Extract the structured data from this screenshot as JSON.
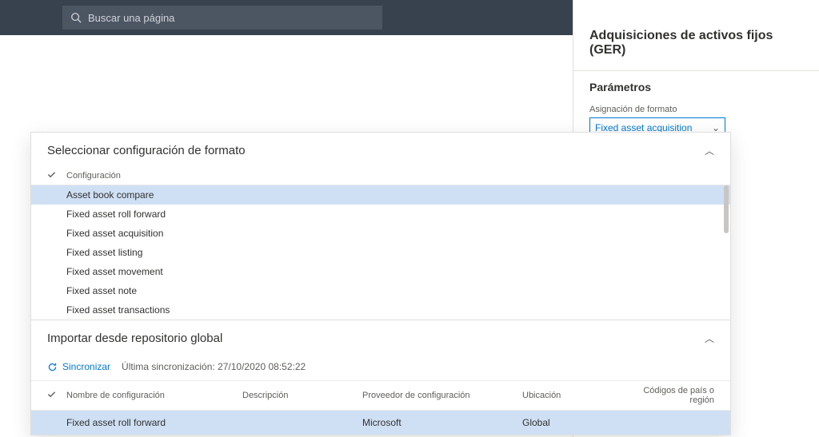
{
  "search": {
    "placeholder": "Buscar una página"
  },
  "rightPanel": {
    "title": "Adquisiciones de activos fijos (GER)",
    "section": "Parámetros",
    "formatFieldLabel": "Asignación de formato",
    "formatValue": "Fixed asset acquisition"
  },
  "overlay": {
    "formatSection": {
      "title": "Seleccionar configuración de formato",
      "columnHeader": "Configuración",
      "items": [
        {
          "name": "Asset book compare",
          "selected": true
        },
        {
          "name": "Fixed asset roll forward",
          "selected": false
        },
        {
          "name": "Fixed asset acquisition",
          "selected": false
        },
        {
          "name": "Fixed asset listing",
          "selected": false
        },
        {
          "name": "Fixed asset movement",
          "selected": false
        },
        {
          "name": "Fixed asset note",
          "selected": false
        },
        {
          "name": "Fixed asset transactions",
          "selected": false
        }
      ]
    },
    "importSection": {
      "title": "Importar desde repositorio global",
      "syncLabel": "Sincronizar",
      "syncInfo": "Última sincronización: 27/10/2020 08:52:22",
      "columns": {
        "name": "Nombre de configuración",
        "desc": "Descripción",
        "prov": "Proveedor de configuración",
        "ubic": "Ubicación",
        "cod": "Códigos de país o región"
      },
      "rows": [
        {
          "name": "Fixed asset roll forward",
          "desc": "",
          "prov": "Microsoft",
          "ubic": "Global",
          "cod": ""
        }
      ]
    }
  }
}
